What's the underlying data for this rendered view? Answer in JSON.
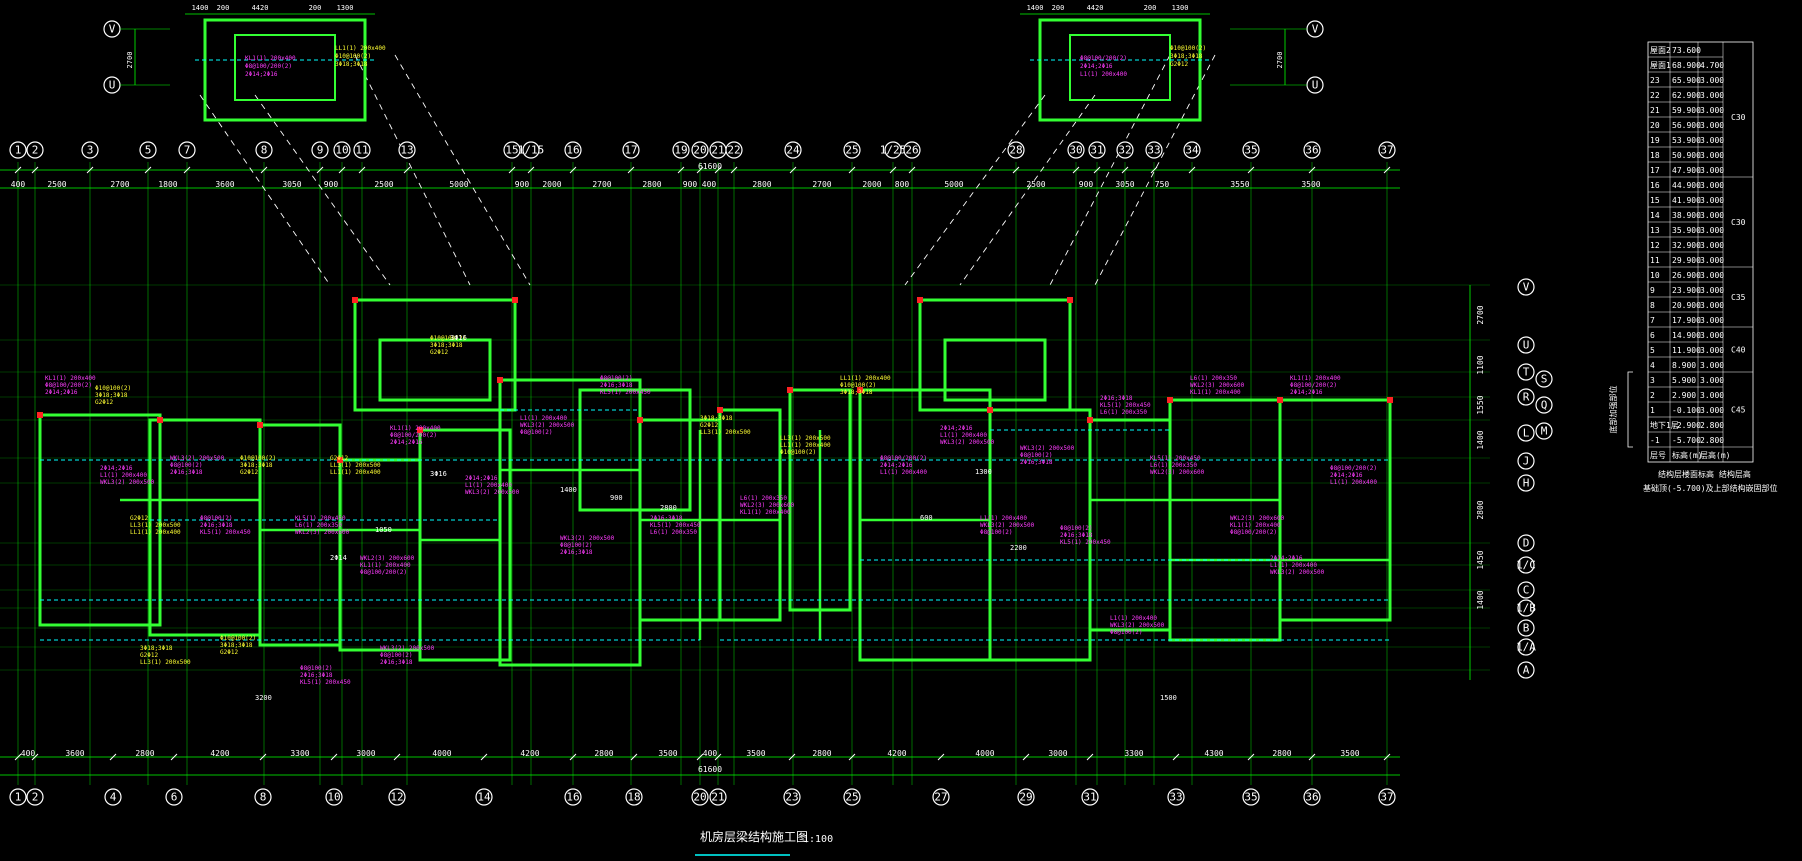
{
  "drawing": {
    "title": "机房层梁结构施工图",
    "scale": "1:100",
    "background": "#000000",
    "colors": {
      "grid": "#00ff00",
      "wall": "#33ff33",
      "beam_dash": "#00ffff",
      "annotation": "#ff33ff",
      "annotation_alt": "#ffff33",
      "text": "#ffffff",
      "column": "#ff2222"
    }
  },
  "grid_axes_top": [
    "1",
    "2",
    "3",
    "5",
    "7",
    "8",
    "9",
    "10",
    "11",
    "13",
    "15",
    "1/15",
    "16",
    "17",
    "19",
    "20",
    "21",
    "22",
    "24",
    "25",
    "1/25",
    "26",
    "28",
    "30",
    "31",
    "32",
    "33",
    "34",
    "35",
    "36",
    "37"
  ],
  "grid_axes_bottom": [
    "1",
    "2",
    "4",
    "6",
    "8",
    "10",
    "12",
    "14",
    "16",
    "18",
    "20",
    "21",
    "23",
    "25",
    "27",
    "29",
    "31",
    "33",
    "35",
    "36",
    "37"
  ],
  "grid_axes_right": [
    "V",
    "U",
    "T",
    "S",
    "R",
    "Q",
    "L",
    "M",
    "J",
    "H",
    "D",
    "1/C",
    "C",
    "1/B",
    "B",
    "1/A",
    "A"
  ],
  "inset_axes": [
    "V",
    "U"
  ],
  "top_dims": [
    "400",
    "2500",
    "2700",
    "1800",
    "3600",
    "3050",
    "900",
    "2500",
    "5000",
    "900",
    "2000",
    "2700",
    "2800",
    "900",
    "400",
    "2800",
    "2700",
    "2000",
    "800",
    "5000",
    "2500",
    "900",
    "3050",
    "750",
    "3550",
    "3500"
  ],
  "top_overall": "61600",
  "bottom_dims": [
    "400",
    "3600",
    "2800",
    "4200",
    "3300",
    "3000",
    "4000",
    "4200",
    "2800",
    "3500",
    "400",
    "3500",
    "2800",
    "4200",
    "4000",
    "3000",
    "3300",
    "4300",
    "2800",
    "3500"
  ],
  "bottom_overall": "61600",
  "right_dims": [
    "2700",
    "1100",
    "1550",
    "1400",
    "2800",
    "1450",
    "1400"
  ],
  "inset_dims": [
    "1400",
    "200",
    "4420",
    "200",
    "1300"
  ],
  "inset_height": "2700",
  "floor_table": {
    "header_roof": "屋面2",
    "rows": [
      {
        "floor": "屋面2",
        "elev": "73.600",
        "height": ""
      },
      {
        "floor": "屋面1",
        "elev": "68.900",
        "height": "4.700"
      },
      {
        "floor": "23",
        "elev": "65.900",
        "height": "3.000"
      },
      {
        "floor": "22",
        "elev": "62.900",
        "height": "3.000"
      },
      {
        "floor": "21",
        "elev": "59.900",
        "height": "3.000"
      },
      {
        "floor": "20",
        "elev": "56.900",
        "height": "3.000"
      },
      {
        "floor": "19",
        "elev": "53.900",
        "height": "3.000"
      },
      {
        "floor": "18",
        "elev": "50.900",
        "height": "3.000"
      },
      {
        "floor": "17",
        "elev": "47.900",
        "height": "3.000"
      },
      {
        "floor": "16",
        "elev": "44.900",
        "height": "3.000"
      },
      {
        "floor": "15",
        "elev": "41.900",
        "height": "3.000"
      },
      {
        "floor": "14",
        "elev": "38.900",
        "height": "3.000"
      },
      {
        "floor": "13",
        "elev": "35.900",
        "height": "3.000"
      },
      {
        "floor": "12",
        "elev": "32.900",
        "height": "3.000"
      },
      {
        "floor": "11",
        "elev": "29.900",
        "height": "3.000"
      },
      {
        "floor": "10",
        "elev": "26.900",
        "height": "3.000"
      },
      {
        "floor": "9",
        "elev": "23.900",
        "height": "3.000"
      },
      {
        "floor": "8",
        "elev": "20.900",
        "height": "3.000"
      },
      {
        "floor": "7",
        "elev": "17.900",
        "height": "3.000"
      },
      {
        "floor": "6",
        "elev": "14.900",
        "height": "3.000"
      },
      {
        "floor": "5",
        "elev": "11.900",
        "height": "3.000"
      },
      {
        "floor": "4",
        "elev": "8.900",
        "height": "3.000"
      },
      {
        "floor": "3",
        "elev": "5.900",
        "height": "3.000"
      },
      {
        "floor": "2",
        "elev": "2.900",
        "height": "3.000"
      },
      {
        "floor": "1",
        "elev": "-0.100",
        "height": "3.000"
      },
      {
        "floor": "地下1层",
        "elev": "-2.900",
        "height": "2.800"
      },
      {
        "floor": "-1",
        "elev": "-5.700",
        "height": "2.800"
      }
    ],
    "concrete_grades": [
      {
        "label": "C30",
        "row_from": 1,
        "row_to": 9
      },
      {
        "label": "C30",
        "row_from": 9,
        "row_to": 15
      },
      {
        "label": "C35",
        "row_from": 15,
        "row_to": 19
      },
      {
        "label": "C40",
        "row_from": 19,
        "row_to": 22
      },
      {
        "label": "C45",
        "row_from": 22,
        "row_to": 27
      }
    ],
    "footer_labels": [
      "层号",
      "标高(m)",
      "层高(m)"
    ],
    "reinforced_zone_label": "底部加强部位",
    "caption_1": "结构层楼面标高 结构层高",
    "caption_2": "基础顶(-5.700)及上部结构嵌固部位"
  },
  "sample_annotations": {
    "magenta": [
      "KL1(1) 200x400",
      "Φ8@100/200(2)",
      "2Φ14;2Φ16",
      "L1(1) 200x400",
      "WKL3(2) 200x500",
      "Φ8@100(2)",
      "2Φ16;3Φ18",
      "KL5(1) 200x450",
      "L6(1) 200x350",
      "WKL2(3) 200x600"
    ],
    "yellow": [
      "LL1(1) 200x400",
      "Φ10@100(2)",
      "3Φ18;3Φ18",
      "G2Φ12",
      "LL3(1) 200x500"
    ],
    "labels": [
      "3Φ16",
      "2Φ14",
      "1400",
      "1300",
      "2200",
      "1050",
      "900",
      "600",
      "3200",
      "1500",
      "2800"
    ]
  }
}
